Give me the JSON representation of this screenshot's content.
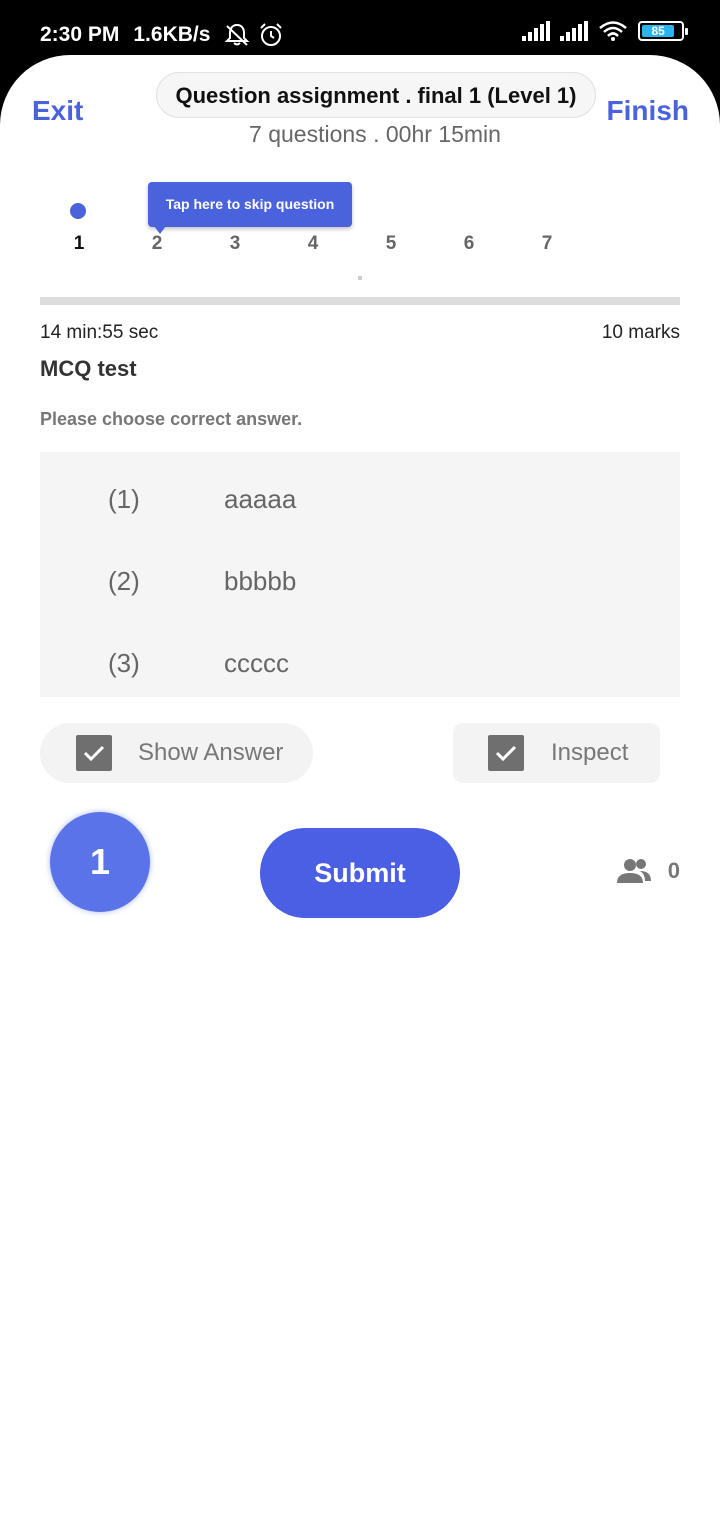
{
  "status_bar": {
    "time": "2:30 PM",
    "network_speed": "1.6KB/s",
    "battery_level": "85",
    "icons": [
      "mute-icon",
      "alarm-icon",
      "signal-icon",
      "signal-icon",
      "wifi-icon",
      "battery-icon"
    ]
  },
  "header": {
    "exit_label": "Exit",
    "finish_label": "Finish",
    "title": "Question assignment . final 1 (Level 1)",
    "subtitle": "7 questions . 00hr 15min"
  },
  "question_nav": {
    "numbers": [
      "1",
      "2",
      "3",
      "4",
      "5",
      "6",
      "7"
    ],
    "active": "1",
    "tooltip": "Tap here to skip question"
  },
  "question": {
    "timer": "14 min:55 sec",
    "marks": "10 marks",
    "title": "MCQ test",
    "instruction": "Please choose correct answer.",
    "options": [
      {
        "number": "(1)",
        "text": "aaaaa"
      },
      {
        "number": "(2)",
        "text": "bbbbb"
      },
      {
        "number": "(3)",
        "text": "ccccc"
      }
    ]
  },
  "controls": {
    "show_answer_label": "Show Answer",
    "inspect_label": "Inspect",
    "count_circle": "1",
    "submit_label": "Submit",
    "participants": "0"
  },
  "colors": {
    "accent": "#4a63dd",
    "submit": "#4a5fe3",
    "counter": "#5a73e8"
  }
}
